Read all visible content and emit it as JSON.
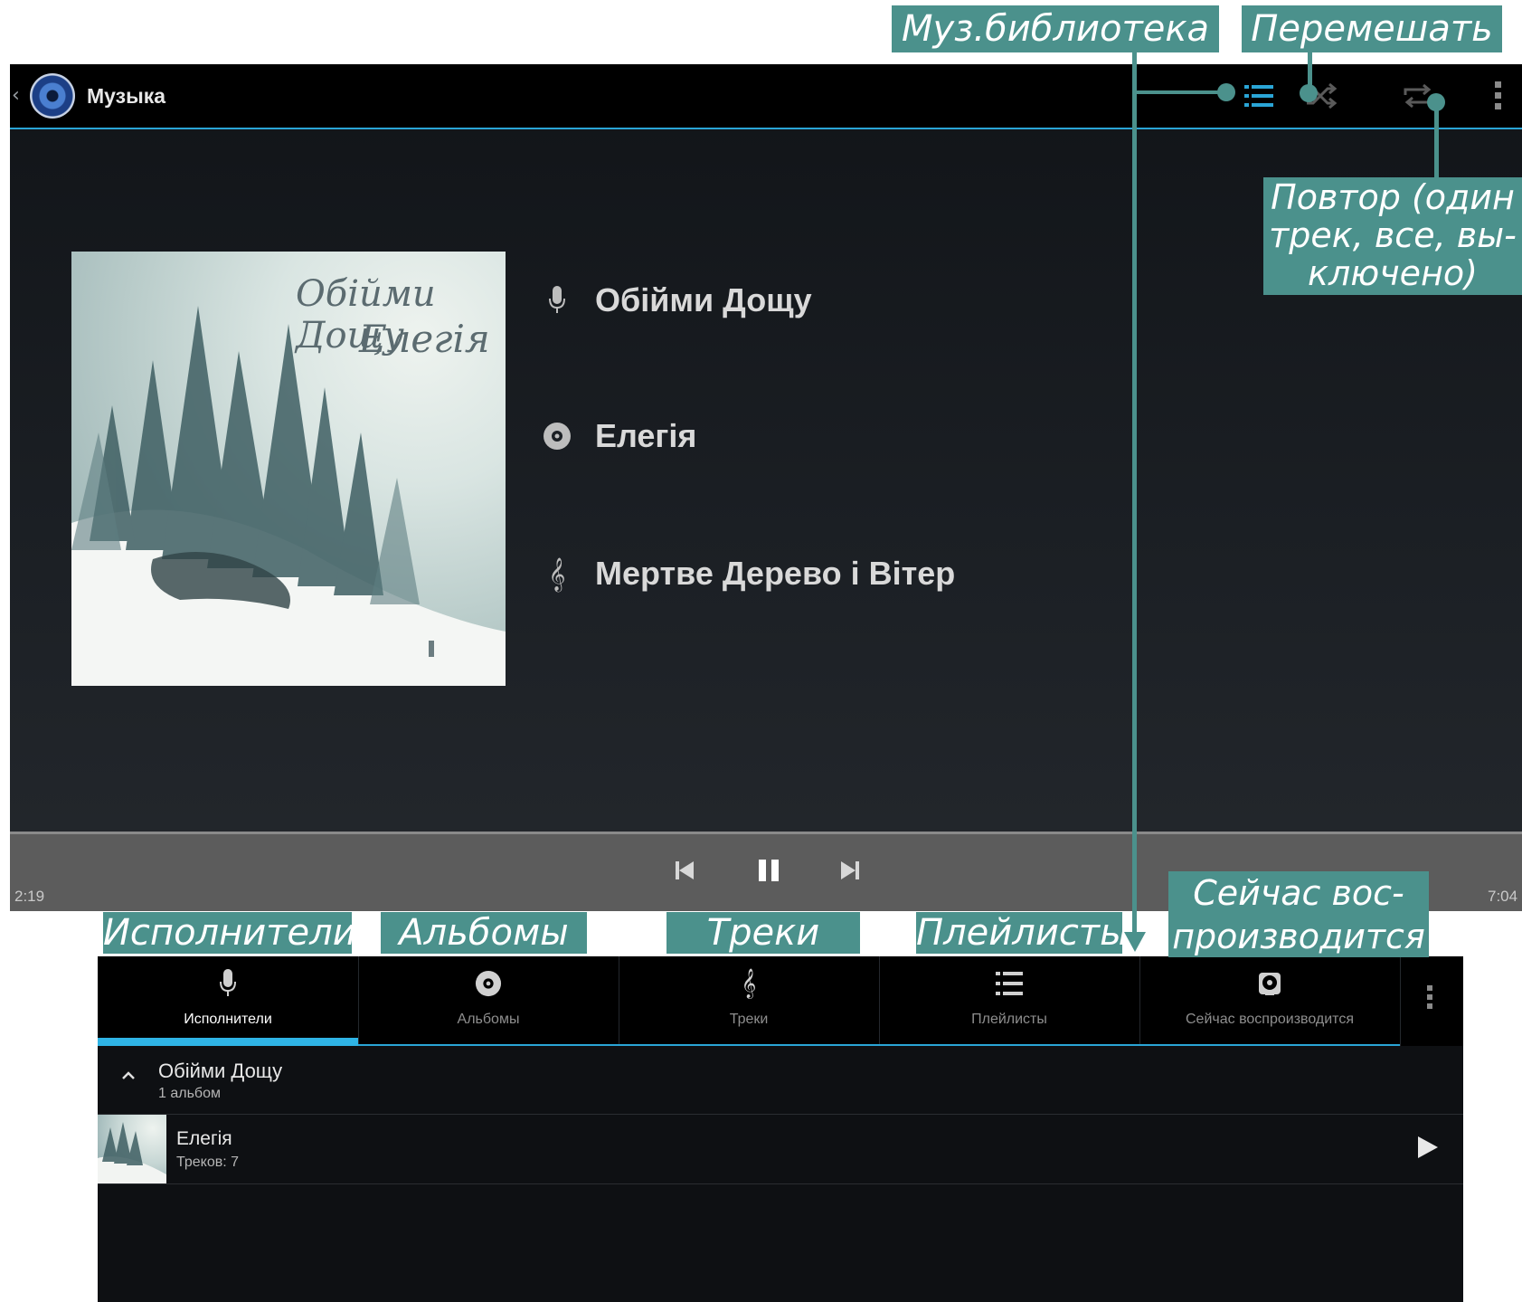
{
  "app": {
    "title": "Музыка"
  },
  "now_playing": {
    "artist": "Обійми Дощу",
    "album": "Елегія",
    "track": "Мертве Дерево і Вітер",
    "cover_text_line1": "Обійми Дощу",
    "cover_text_line2": "Елегія",
    "elapsed": "2:19",
    "duration": "7:04"
  },
  "actionbar_icons": [
    "library-icon",
    "shuffle-icon",
    "repeat-icon",
    "overflow-menu-icon"
  ],
  "tabs": [
    {
      "label": "Исполнители",
      "icon": "microphone-icon",
      "active": true
    },
    {
      "label": "Альбомы",
      "icon": "disc-icon",
      "active": false
    },
    {
      "label": "Треки",
      "icon": "treble-clef-icon",
      "active": false
    },
    {
      "label": "Плейлисты",
      "icon": "playlist-icon",
      "active": false
    },
    {
      "label": "Сейчас воспроизводится",
      "icon": "now-playing-icon",
      "active": false
    }
  ],
  "library_list": {
    "artist_name": "Обійми Дощу",
    "artist_albums": "1 альбом",
    "album_name": "Елегія",
    "album_tracks": "Треков: 7"
  },
  "callouts": {
    "library": "Муз.библиотека",
    "shuffle": "Перемешать",
    "repeat_line1": "Повтор (один",
    "repeat_line2": "трек, все, вы-",
    "repeat_line3": "ключено)",
    "artists": "Исполнители",
    "albums": "Альбомы",
    "tracks": "Треки",
    "playlists": "Плейлисты",
    "nowplaying_line1": "Сейчас вос-",
    "nowplaying_line2": "производится"
  },
  "colors": {
    "accent": "#2aa5d6",
    "callout": "#4b918c",
    "background": "#1b1f24"
  }
}
